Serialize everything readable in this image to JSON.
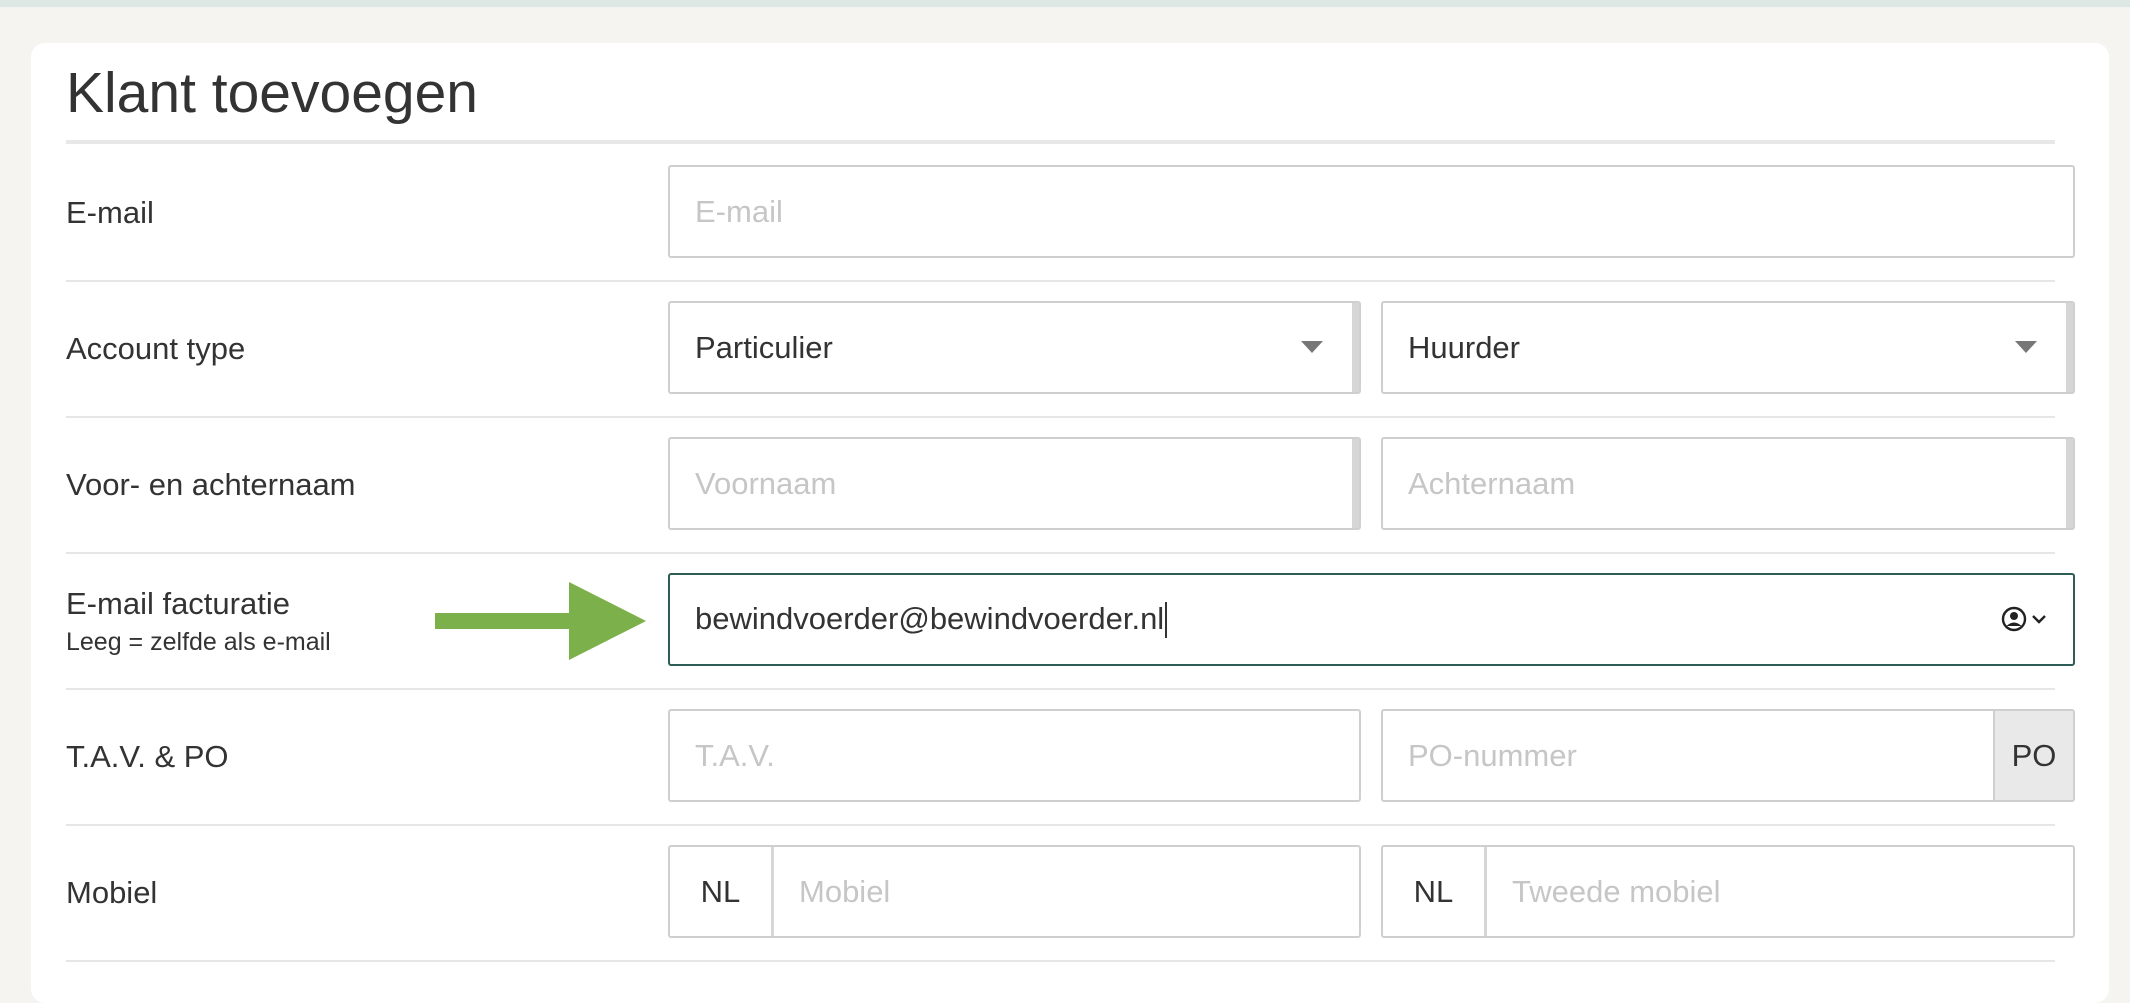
{
  "form": {
    "title": "Klant toevoegen",
    "rows": {
      "email": {
        "label": "E-mail",
        "placeholder": "E-mail"
      },
      "account_type": {
        "label": "Account type",
        "type_value": "Particulier",
        "role_value": "Huurder"
      },
      "name": {
        "label": "Voor- en achternaam",
        "first_placeholder": "Voornaam",
        "last_placeholder": "Achternaam"
      },
      "billing_email": {
        "label": "E-mail facturatie",
        "hint": "Leeg = zelfde als e-mail",
        "value": "bewindvoerder@bewindvoerder.nl"
      },
      "attn_po": {
        "label": "T.A.V. & PO",
        "attn_placeholder": "T.A.V.",
        "po_placeholder": "PO-nummer",
        "po_addon": "PO"
      },
      "mobile": {
        "label": "Mobiel",
        "country_code": "NL",
        "mobile_placeholder": "Mobiel",
        "country_code_2": "NL",
        "second_placeholder": "Tweede mobiel"
      }
    }
  },
  "icons": {
    "autofill": "contact-card-icon",
    "dropdown": "chevron-down-icon",
    "annotation": "arrow-right-icon"
  },
  "colors": {
    "focus_border": "#2e5d57",
    "annotation_arrow": "#7cb04a"
  }
}
